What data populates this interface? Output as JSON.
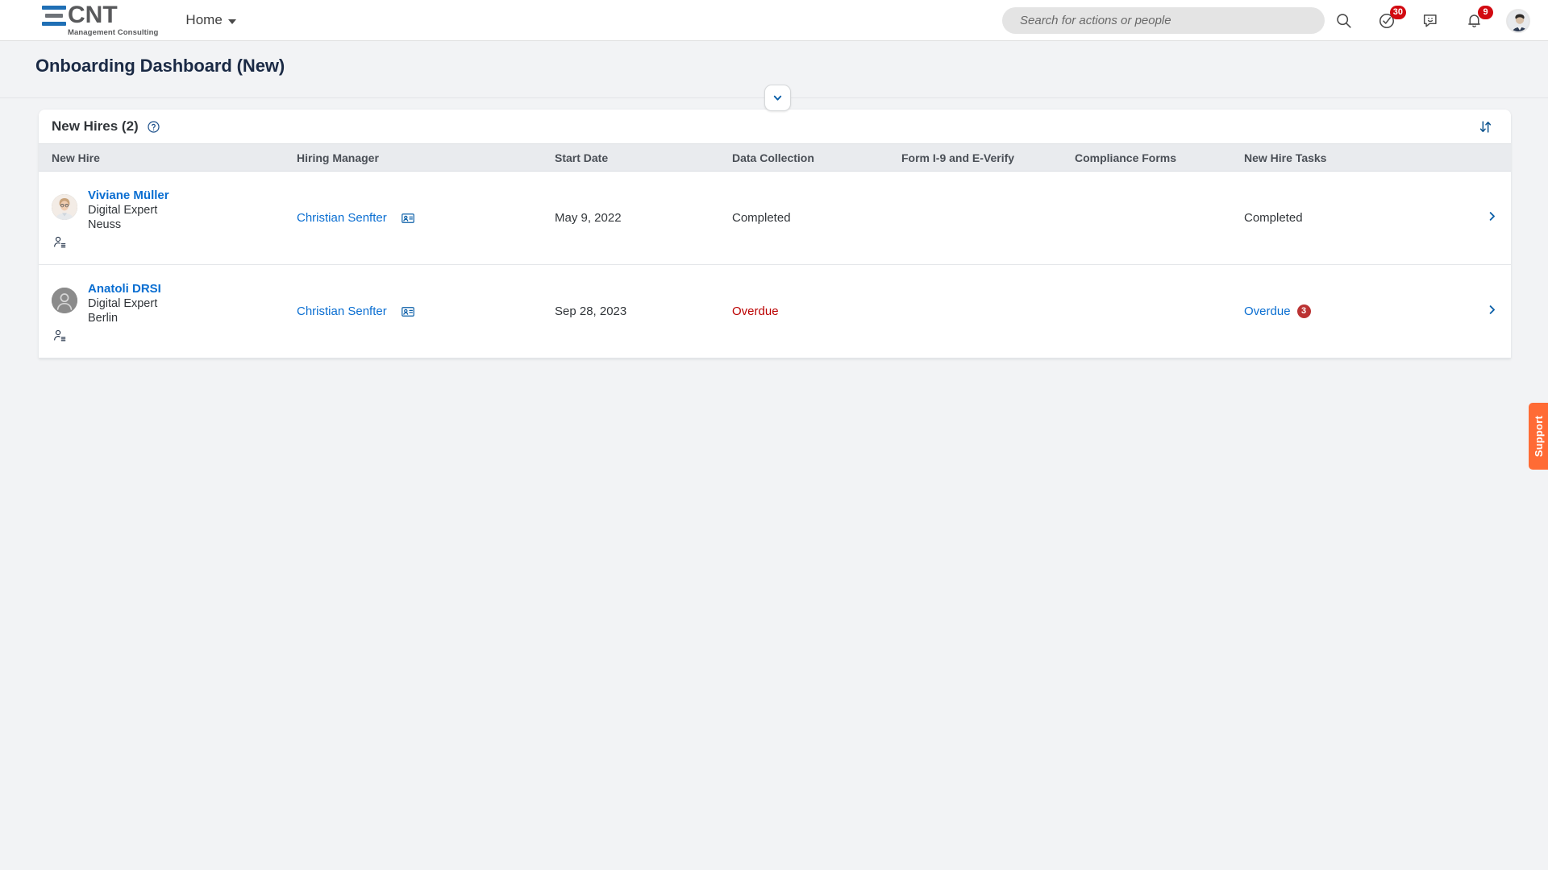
{
  "header": {
    "logo_word": "CNT",
    "logo_sub": "Management Consulting",
    "nav_home": "Home",
    "search_placeholder": "Search for actions or people",
    "notifications_badge": "9",
    "tasks_badge": "30"
  },
  "page": {
    "title": "Onboarding Dashboard (New)"
  },
  "card": {
    "title": "New Hires (2)",
    "columns": [
      "New Hire",
      "Hiring Manager",
      "Start Date",
      "Data Collection",
      "Form I-9 and E-Verify",
      "Compliance Forms",
      "New Hire Tasks"
    ],
    "rows": [
      {
        "name": "Viviane Müller",
        "job_title": "Digital Expert",
        "location": "Neuss",
        "hiring_manager": "Christian Senfter",
        "start_date": "May 9, 2022",
        "data_collection": "Completed",
        "form_i9": "",
        "compliance_forms": "",
        "new_hire_tasks": "Completed",
        "new_hire_tasks_badge": "",
        "data_collection_state": "completed",
        "tasks_state": "completed",
        "avatar_type": "photo"
      },
      {
        "name": "Anatoli DRSI",
        "job_title": "Digital Expert",
        "location": "Berlin",
        "hiring_manager": "Christian Senfter",
        "start_date": "Sep 28, 2023",
        "data_collection": "Overdue",
        "form_i9": "",
        "compliance_forms": "",
        "new_hire_tasks": "Overdue",
        "new_hire_tasks_badge": "3",
        "data_collection_state": "overdue",
        "tasks_state": "overdue",
        "avatar_type": "placeholder"
      }
    ]
  },
  "support": {
    "label": "Support"
  },
  "colors": {
    "link": "#0a6ed1",
    "danger": "#bb0000",
    "badge": "#d20a11",
    "support": "#ff6b35",
    "title": "#1b2a45"
  }
}
